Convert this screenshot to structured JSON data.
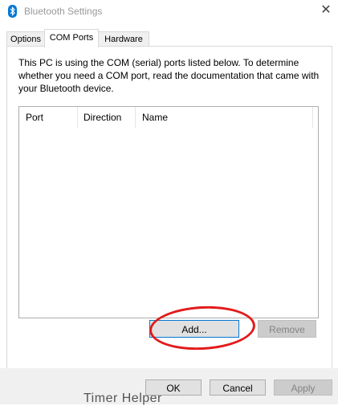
{
  "window": {
    "title": "Bluetooth Settings",
    "icon": "bluetooth-icon",
    "close_glyph": "✕"
  },
  "tabs": [
    {
      "label": "Options",
      "active": false
    },
    {
      "label": "COM Ports",
      "active": true
    },
    {
      "label": "Hardware",
      "active": false
    }
  ],
  "com_ports": {
    "description": "This PC is using the COM (serial) ports listed below. To determine whether you need a COM port, read the documentation that came with your Bluetooth device.",
    "columns": [
      "Port",
      "Direction",
      "Name"
    ],
    "rows": [],
    "add_label": "Add...",
    "remove_label": "Remove"
  },
  "footer": {
    "ok_label": "OK",
    "cancel_label": "Cancel",
    "apply_label": "Apply"
  },
  "background_text": "Timer Helper",
  "colors": {
    "accent": "#0078d7",
    "annotation": "#e21b1b"
  }
}
